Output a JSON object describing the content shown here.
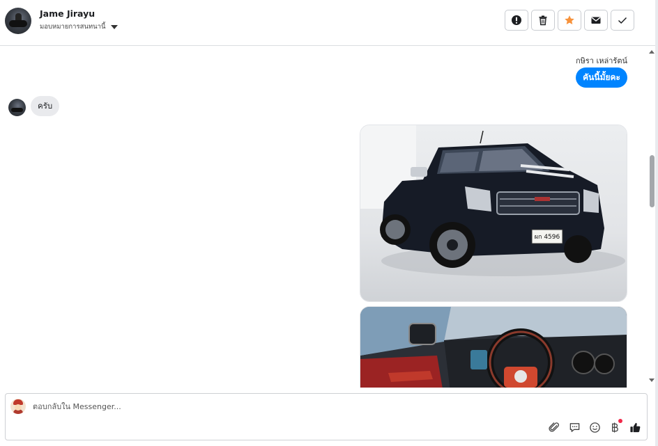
{
  "header": {
    "contact_name": "Jame Jirayu",
    "assign_label": "มอบหมายการสนทนานี้",
    "actions": [
      {
        "name": "report-spam-icon"
      },
      {
        "name": "trash-icon"
      },
      {
        "name": "star-icon",
        "color": "#f7923b"
      },
      {
        "name": "mail-icon"
      },
      {
        "name": "check-icon"
      }
    ]
  },
  "thread": {
    "outgoing_sender": "กษิรา เหล่ารัตน์",
    "outgoing_message": "คันนี้มั้ยคะ",
    "incoming_message": "ครับ",
    "photos": [
      {
        "alt": "black pickup truck",
        "plate": "ผก 4596"
      },
      {
        "alt": "truck interior dashboard"
      }
    ]
  },
  "composer": {
    "placeholder": "ตอบกลับใน Messenger...",
    "icons": [
      "attachment-icon",
      "saved-replies-icon",
      "emoji-icon",
      "baht-icon",
      "like-icon"
    ]
  },
  "colors": {
    "accent": "#0084ff",
    "incoming_bubble": "#e9eaed",
    "star": "#f7923b",
    "notification_dot": "#f02849"
  }
}
